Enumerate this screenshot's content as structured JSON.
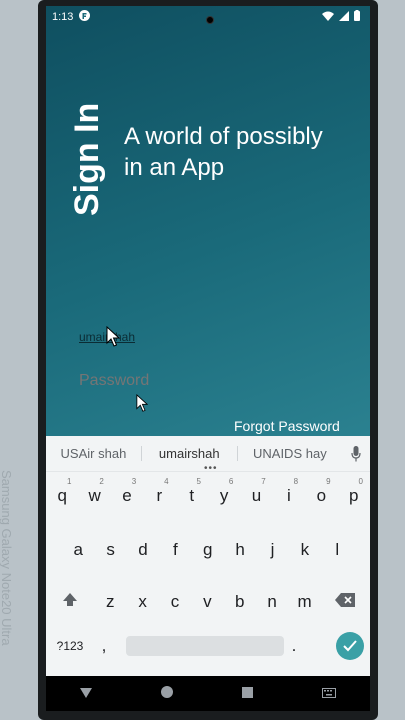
{
  "status_bar": {
    "time": "1:13"
  },
  "device_label": "Samsung Galaxy Note20 Ultra",
  "app": {
    "sign_in_label": "Sign In",
    "tagline": "A world of possibly in an App",
    "username_value": "umairshah",
    "password_placeholder": "Password",
    "forgot_password": "Forgot Password"
  },
  "keyboard": {
    "suggestions": [
      "USAir shah",
      "umairshah",
      "UNAIDS hay"
    ],
    "row1": [
      "q",
      "w",
      "e",
      "r",
      "t",
      "y",
      "u",
      "i",
      "o",
      "p"
    ],
    "row1_hints": [
      "1",
      "2",
      "3",
      "4",
      "5",
      "6",
      "7",
      "8",
      "9",
      "0"
    ],
    "row2": [
      "a",
      "s",
      "d",
      "f",
      "g",
      "h",
      "j",
      "k",
      "l"
    ],
    "row3": [
      "z",
      "x",
      "c",
      "v",
      "b",
      "n",
      "m"
    ],
    "symbols_key": "?123",
    "comma": ",",
    "period": "."
  },
  "colors": {
    "app_bg": "#1a6a7a",
    "enter_key": "#3aa0a6"
  }
}
